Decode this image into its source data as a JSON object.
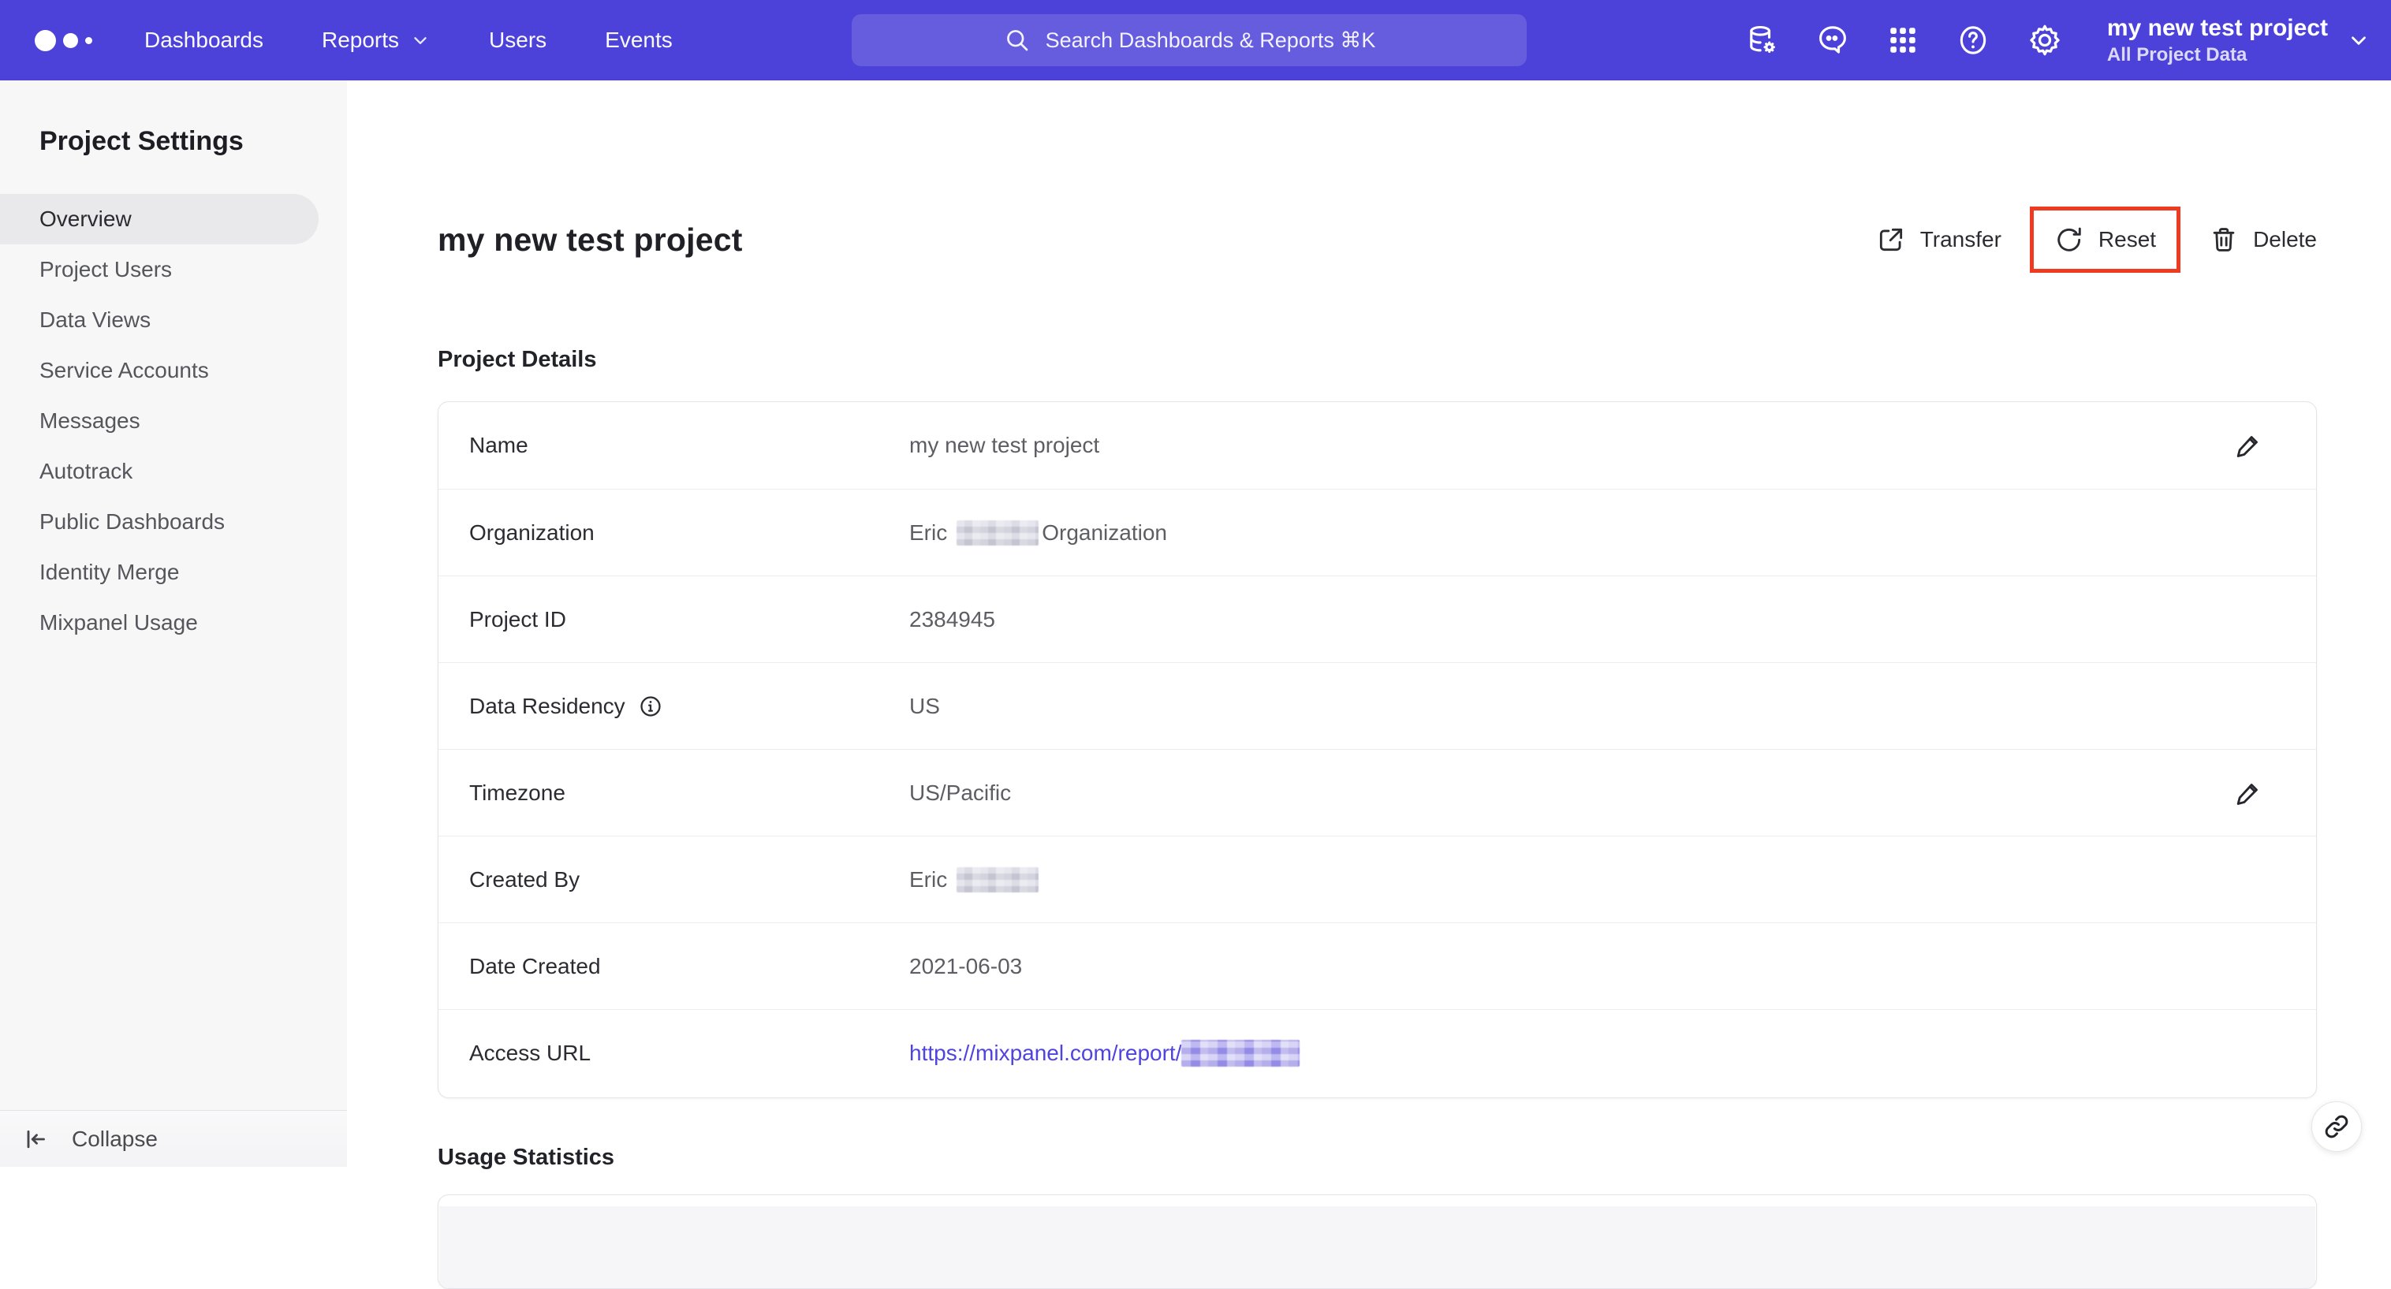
{
  "colors": {
    "nav_purple": "#4c42d9",
    "accent": "#4f44e0",
    "highlight_red": "#ee3a21"
  },
  "nav": {
    "links": [
      {
        "label": "Dashboards"
      },
      {
        "label": "Reports"
      },
      {
        "label": "Users"
      },
      {
        "label": "Events"
      }
    ],
    "search_placeholder": "Search Dashboards & Reports ⌘K",
    "project_switcher": {
      "name": "my new test project",
      "scope": "All Project Data"
    }
  },
  "sidebar": {
    "title": "Project Settings",
    "items": [
      {
        "label": "Overview",
        "active": true
      },
      {
        "label": "Project Users"
      },
      {
        "label": "Data Views"
      },
      {
        "label": "Service Accounts"
      },
      {
        "label": "Messages"
      },
      {
        "label": "Autotrack"
      },
      {
        "label": "Public Dashboards"
      },
      {
        "label": "Identity Merge"
      },
      {
        "label": "Mixpanel Usage"
      }
    ],
    "collapse_label": "Collapse"
  },
  "main": {
    "page_title": "my new test project",
    "actions": [
      {
        "label": "Transfer"
      },
      {
        "label": "Reset",
        "highlighted": true
      },
      {
        "label": "Delete"
      }
    ],
    "sections": {
      "details_title": "Project Details",
      "usage_title": "Usage Statistics"
    },
    "details": {
      "rows": [
        {
          "label": "Name",
          "value": "my new test project"
        },
        {
          "label": "Organization",
          "value_prefix": "Eric",
          "value_suffix": "Organization"
        },
        {
          "label": "Project ID",
          "value": "2384945"
        },
        {
          "label": "Data Residency",
          "value": "US"
        },
        {
          "label": "Timezone",
          "value": "US/Pacific"
        },
        {
          "label": "Created By",
          "value_prefix": "Eric"
        },
        {
          "label": "Date Created",
          "value": "2021-06-03"
        },
        {
          "label": "Access URL",
          "link_prefix": "https://mixpanel.com/report/"
        }
      ]
    }
  }
}
